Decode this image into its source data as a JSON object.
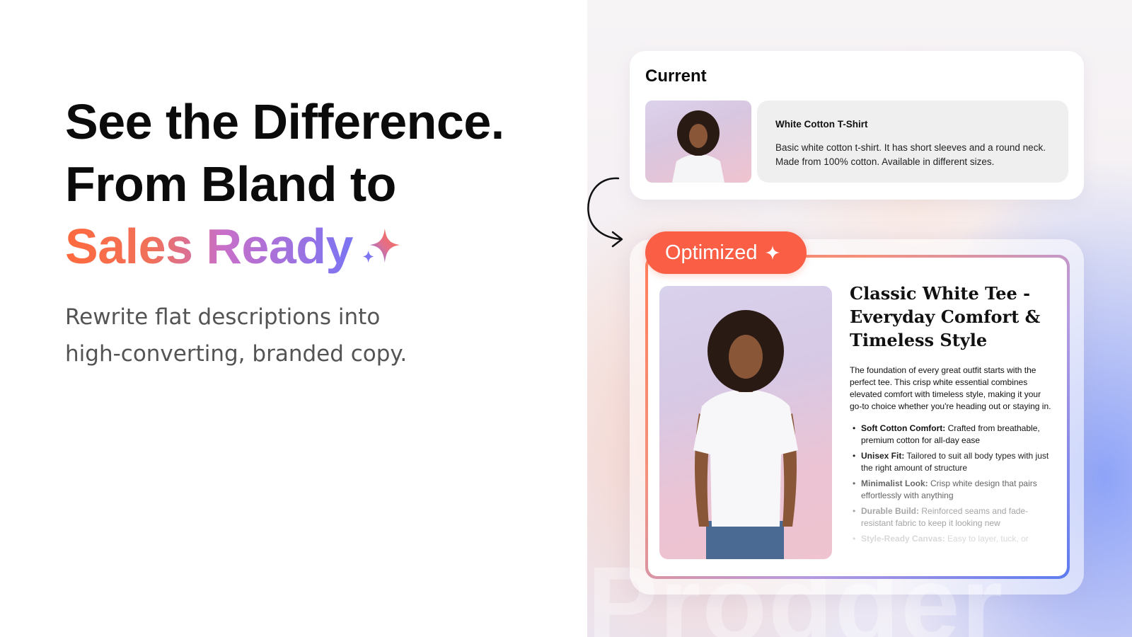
{
  "hero": {
    "line1": "See the Difference.",
    "line2": "From Bland to",
    "line3_part1": "Sales Ready",
    "subtitle_line1": "Rewrite flat descriptions into",
    "subtitle_line2": "high-converting, branded copy."
  },
  "watermark": "Prodder",
  "current": {
    "label": "Current",
    "product_title": "White Cotton T-Shirt",
    "product_body": "Basic white cotton t-shirt. It has short sleeves and a round neck. Made from 100% cotton. Available in different sizes."
  },
  "optimized": {
    "label": "Optimized",
    "title": "Classic White Tee - Everyday Comfort & Timeless Style",
    "paragraph": "The foundation of every great outfit starts with the perfect tee. This crisp white essential combines elevated comfort with timeless style, making it your go-to choice whether you're heading out or staying in.",
    "bullets": [
      {
        "label": "Soft Cotton Comfort:",
        "text": " Crafted from breathable, premium cotton for all-day ease"
      },
      {
        "label": "Unisex Fit:",
        "text": " Tailored to suit all body types with just the right amount of structure"
      },
      {
        "label": "Minimalist Look:",
        "text": " Crisp white design that pairs effortlessly with anything"
      },
      {
        "label": "Durable Build:",
        "text": " Reinforced seams and fade-resistant fabric to keep it looking new"
      },
      {
        "label": "Style-Ready Canvas:",
        "text": " Easy to layer, tuck, or"
      }
    ]
  },
  "colors": {
    "accent_orange": "#fa5e45",
    "gradient_start": "#ff6a3d",
    "gradient_end": "#7b74f3"
  },
  "icons": {
    "hero_sparkle": "sparkle-icon",
    "pill_sparkle": "sparkle-icon",
    "arrow": "curved-arrow-icon"
  }
}
